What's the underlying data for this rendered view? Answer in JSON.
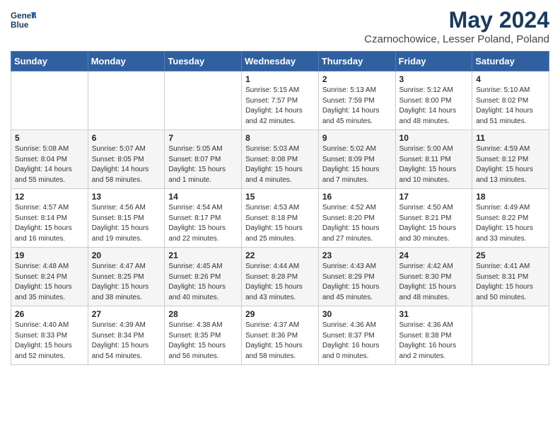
{
  "header": {
    "logo_line1": "General",
    "logo_line2": "Blue",
    "title": "May 2024",
    "subtitle": "Czarnochowice, Lesser Poland, Poland"
  },
  "days_of_week": [
    "Sunday",
    "Monday",
    "Tuesday",
    "Wednesday",
    "Thursday",
    "Friday",
    "Saturday"
  ],
  "weeks": [
    [
      {
        "day": "",
        "sunrise": "",
        "sunset": "",
        "daylight": ""
      },
      {
        "day": "",
        "sunrise": "",
        "sunset": "",
        "daylight": ""
      },
      {
        "day": "",
        "sunrise": "",
        "sunset": "",
        "daylight": ""
      },
      {
        "day": "1",
        "sunrise": "Sunrise: 5:15 AM",
        "sunset": "Sunset: 7:57 PM",
        "daylight": "Daylight: 14 hours and 42 minutes."
      },
      {
        "day": "2",
        "sunrise": "Sunrise: 5:13 AM",
        "sunset": "Sunset: 7:59 PM",
        "daylight": "Daylight: 14 hours and 45 minutes."
      },
      {
        "day": "3",
        "sunrise": "Sunrise: 5:12 AM",
        "sunset": "Sunset: 8:00 PM",
        "daylight": "Daylight: 14 hours and 48 minutes."
      },
      {
        "day": "4",
        "sunrise": "Sunrise: 5:10 AM",
        "sunset": "Sunset: 8:02 PM",
        "daylight": "Daylight: 14 hours and 51 minutes."
      }
    ],
    [
      {
        "day": "5",
        "sunrise": "Sunrise: 5:08 AM",
        "sunset": "Sunset: 8:04 PM",
        "daylight": "Daylight: 14 hours and 55 minutes."
      },
      {
        "day": "6",
        "sunrise": "Sunrise: 5:07 AM",
        "sunset": "Sunset: 8:05 PM",
        "daylight": "Daylight: 14 hours and 58 minutes."
      },
      {
        "day": "7",
        "sunrise": "Sunrise: 5:05 AM",
        "sunset": "Sunset: 8:07 PM",
        "daylight": "Daylight: 15 hours and 1 minute."
      },
      {
        "day": "8",
        "sunrise": "Sunrise: 5:03 AM",
        "sunset": "Sunset: 8:08 PM",
        "daylight": "Daylight: 15 hours and 4 minutes."
      },
      {
        "day": "9",
        "sunrise": "Sunrise: 5:02 AM",
        "sunset": "Sunset: 8:09 PM",
        "daylight": "Daylight: 15 hours and 7 minutes."
      },
      {
        "day": "10",
        "sunrise": "Sunrise: 5:00 AM",
        "sunset": "Sunset: 8:11 PM",
        "daylight": "Daylight: 15 hours and 10 minutes."
      },
      {
        "day": "11",
        "sunrise": "Sunrise: 4:59 AM",
        "sunset": "Sunset: 8:12 PM",
        "daylight": "Daylight: 15 hours and 13 minutes."
      }
    ],
    [
      {
        "day": "12",
        "sunrise": "Sunrise: 4:57 AM",
        "sunset": "Sunset: 8:14 PM",
        "daylight": "Daylight: 15 hours and 16 minutes."
      },
      {
        "day": "13",
        "sunrise": "Sunrise: 4:56 AM",
        "sunset": "Sunset: 8:15 PM",
        "daylight": "Daylight: 15 hours and 19 minutes."
      },
      {
        "day": "14",
        "sunrise": "Sunrise: 4:54 AM",
        "sunset": "Sunset: 8:17 PM",
        "daylight": "Daylight: 15 hours and 22 minutes."
      },
      {
        "day": "15",
        "sunrise": "Sunrise: 4:53 AM",
        "sunset": "Sunset: 8:18 PM",
        "daylight": "Daylight: 15 hours and 25 minutes."
      },
      {
        "day": "16",
        "sunrise": "Sunrise: 4:52 AM",
        "sunset": "Sunset: 8:20 PM",
        "daylight": "Daylight: 15 hours and 27 minutes."
      },
      {
        "day": "17",
        "sunrise": "Sunrise: 4:50 AM",
        "sunset": "Sunset: 8:21 PM",
        "daylight": "Daylight: 15 hours and 30 minutes."
      },
      {
        "day": "18",
        "sunrise": "Sunrise: 4:49 AM",
        "sunset": "Sunset: 8:22 PM",
        "daylight": "Daylight: 15 hours and 33 minutes."
      }
    ],
    [
      {
        "day": "19",
        "sunrise": "Sunrise: 4:48 AM",
        "sunset": "Sunset: 8:24 PM",
        "daylight": "Daylight: 15 hours and 35 minutes."
      },
      {
        "day": "20",
        "sunrise": "Sunrise: 4:47 AM",
        "sunset": "Sunset: 8:25 PM",
        "daylight": "Daylight: 15 hours and 38 minutes."
      },
      {
        "day": "21",
        "sunrise": "Sunrise: 4:45 AM",
        "sunset": "Sunset: 8:26 PM",
        "daylight": "Daylight: 15 hours and 40 minutes."
      },
      {
        "day": "22",
        "sunrise": "Sunrise: 4:44 AM",
        "sunset": "Sunset: 8:28 PM",
        "daylight": "Daylight: 15 hours and 43 minutes."
      },
      {
        "day": "23",
        "sunrise": "Sunrise: 4:43 AM",
        "sunset": "Sunset: 8:29 PM",
        "daylight": "Daylight: 15 hours and 45 minutes."
      },
      {
        "day": "24",
        "sunrise": "Sunrise: 4:42 AM",
        "sunset": "Sunset: 8:30 PM",
        "daylight": "Daylight: 15 hours and 48 minutes."
      },
      {
        "day": "25",
        "sunrise": "Sunrise: 4:41 AM",
        "sunset": "Sunset: 8:31 PM",
        "daylight": "Daylight: 15 hours and 50 minutes."
      }
    ],
    [
      {
        "day": "26",
        "sunrise": "Sunrise: 4:40 AM",
        "sunset": "Sunset: 8:33 PM",
        "daylight": "Daylight: 15 hours and 52 minutes."
      },
      {
        "day": "27",
        "sunrise": "Sunrise: 4:39 AM",
        "sunset": "Sunset: 8:34 PM",
        "daylight": "Daylight: 15 hours and 54 minutes."
      },
      {
        "day": "28",
        "sunrise": "Sunrise: 4:38 AM",
        "sunset": "Sunset: 8:35 PM",
        "daylight": "Daylight: 15 hours and 56 minutes."
      },
      {
        "day": "29",
        "sunrise": "Sunrise: 4:37 AM",
        "sunset": "Sunset: 8:36 PM",
        "daylight": "Daylight: 15 hours and 58 minutes."
      },
      {
        "day": "30",
        "sunrise": "Sunrise: 4:36 AM",
        "sunset": "Sunset: 8:37 PM",
        "daylight": "Daylight: 16 hours and 0 minutes."
      },
      {
        "day": "31",
        "sunrise": "Sunrise: 4:36 AM",
        "sunset": "Sunset: 8:38 PM",
        "daylight": "Daylight: 16 hours and 2 minutes."
      },
      {
        "day": "",
        "sunrise": "",
        "sunset": "",
        "daylight": ""
      }
    ]
  ]
}
